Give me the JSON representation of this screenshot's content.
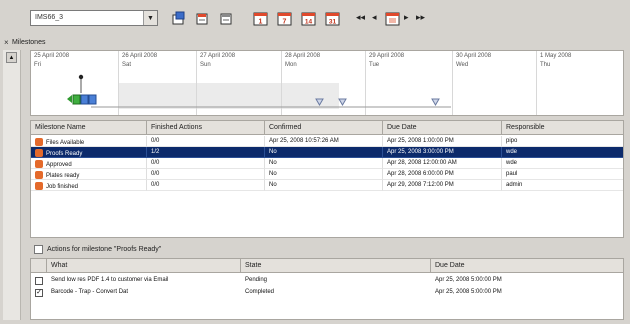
{
  "toolbar": {
    "combo_value": "IMS66_3",
    "combo_arrow": "▼",
    "buttons": [
      {
        "icon": "new-milestone-icon",
        "color": "#3b6cc9"
      },
      {
        "icon": "edit-milestone-icon",
        "color": "#e0492c"
      },
      {
        "icon": "delete-milestone-icon",
        "color": "#6b6b6b"
      },
      {
        "icon": "calendar-day-icon",
        "label": "1",
        "color": "#e0492c"
      },
      {
        "icon": "calendar-week-icon",
        "label": "7",
        "color": "#e0492c"
      },
      {
        "icon": "calendar-2week-icon",
        "label": "14",
        "color": "#e0492c"
      },
      {
        "icon": "calendar-month-icon",
        "label": "31",
        "color": "#e0492c"
      }
    ],
    "nav_first": "◂◂",
    "nav_prev": "◂",
    "today_icon": "today-icon",
    "nav_next": "▸",
    "nav_last": "▸▸"
  },
  "milestones_panel": {
    "close": "×",
    "title": "Milestones"
  },
  "timeline": {
    "columns": [
      {
        "date": "25 April   2008",
        "day": "Fri"
      },
      {
        "date": "26 April   2008",
        "day": "Sat"
      },
      {
        "date": "27 April   2008",
        "day": "Sun"
      },
      {
        "date": "28 April   2008",
        "day": "Mon"
      },
      {
        "date": "29 April   2008",
        "day": "Tue"
      },
      {
        "date": "30 April   2008",
        "day": "Wed"
      },
      {
        "date": "1 May   2008",
        "day": "Thu"
      }
    ]
  },
  "grid": {
    "headers": [
      "Milestone Name",
      "Finished Actions",
      "Confirmed",
      "Due Date",
      "Responsible"
    ],
    "rows": [
      {
        "name": "Files Available",
        "finished": "0/0",
        "confirmed": "Apr 25, 2008 10:57:26 AM",
        "due": "Apr 25, 2008 1:00:00 PM",
        "responsible": "pipo",
        "selected": false
      },
      {
        "name": "Proofs Ready",
        "finished": "1/2",
        "confirmed": "No",
        "due": "Apr 25, 2008 3:00:00 PM",
        "responsible": "wde",
        "selected": true
      },
      {
        "name": "Approved",
        "finished": "0/0",
        "confirmed": "No",
        "due": "Apr 28, 2008 12:00:00 AM",
        "responsible": "wde",
        "selected": false
      },
      {
        "name": "Plates ready",
        "finished": "0/0",
        "confirmed": "No",
        "due": "Apr 28, 2008 6:00:00 PM",
        "responsible": "paul",
        "selected": false
      },
      {
        "name": "Job finished",
        "finished": "0/0",
        "confirmed": "No",
        "due": "Apr 29, 2008 7:12:00 PM",
        "responsible": "admin",
        "selected": false
      }
    ]
  },
  "actions": {
    "title": "Actions for milestone \"Proofs Ready\"",
    "headers": [
      "What",
      "State",
      "Due Date"
    ],
    "rows": [
      {
        "checked": false,
        "what": "Send low res PDF 1.4 to customer via Email",
        "state": "Pending",
        "due": "Apr 25, 2008 5:00:00 PM"
      },
      {
        "checked": true,
        "what": "Barcode - Trap - Convert Dat",
        "state": "Completed",
        "due": "Apr 25, 2008 5:00:00 PM"
      }
    ]
  }
}
